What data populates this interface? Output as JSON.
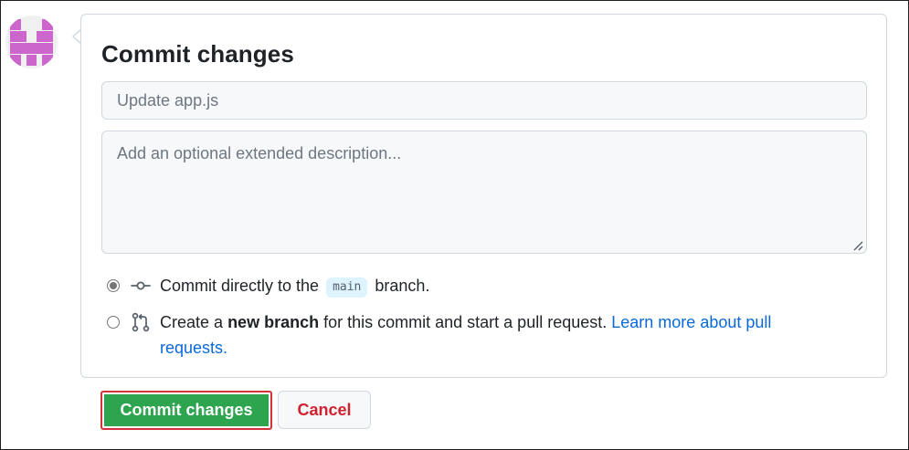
{
  "commit_form": {
    "title": "Commit changes",
    "summary_placeholder": "Update app.js",
    "summary_value": "",
    "description_placeholder": "Add an optional extended description...",
    "description_value": "",
    "options": {
      "direct": {
        "selected": true,
        "icon": "git-commit-icon",
        "text_before": "Commit directly to the",
        "branch_name": "main",
        "text_after": "branch."
      },
      "new_branch": {
        "selected": false,
        "icon": "git-pull-request-icon",
        "text_before": "Create a",
        "bold_text": "new branch",
        "text_after": "for this commit and start a pull request.",
        "link_text": "Learn more about pull requests."
      }
    }
  },
  "buttons": {
    "commit_label": "Commit changes",
    "cancel_label": "Cancel"
  },
  "avatar": {
    "icon": "identicon-avatar",
    "color": "#cc66cc"
  },
  "colors": {
    "primary_button": "#2da44e",
    "cancel_text": "#cf222e",
    "link": "#0969da",
    "highlight_border": "#d13438"
  }
}
